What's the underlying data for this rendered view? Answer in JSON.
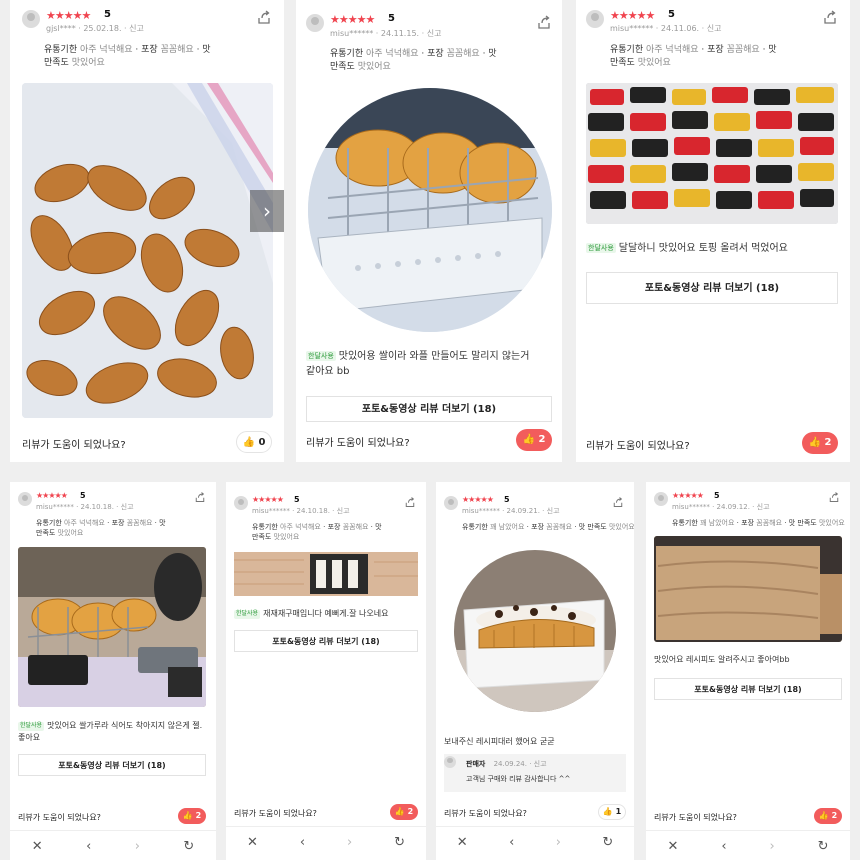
{
  "common": {
    "stars": "★★★★★",
    "score": "5",
    "report": "신고",
    "helpful_q": "리뷰가 도움이 되었나요?",
    "more_btn": "포토&동영상 리뷰 더보기 (18)",
    "badge": "한달사용",
    "share_icon": "share-icon",
    "like_icon": "thumbs-up-icon"
  },
  "colors": {
    "accent": "#f25c5c",
    "star": "#f0444f",
    "badge_green": "#2c9a3a"
  },
  "cards": [
    {
      "user": "gjsl****",
      "date": "25.02.18.",
      "tags_line1": "유통기한",
      "tags_line1_val": "아주 넉넉해요",
      "tags_line2": "포장",
      "tags_line2_val": "꼼꼼해요",
      "tags_line3": "맛",
      "tags_line4": "만족도",
      "tags_line4_val": "맛있어요",
      "votes": "0"
    },
    {
      "user": "misu******",
      "date": "24.11.15.",
      "tags_line1": "유통기한",
      "tags_line1_val": "아주 넉넉해요",
      "tags_line2": "포장",
      "tags_line2_val": "꼼꼼해요",
      "tags_line3": "맛",
      "tags_line4": "만족도",
      "tags_line4_val": "맛있어요",
      "review": "맛있어용 쌀이라 와플 만들어도 말리지 않는거 같아요 bb",
      "votes": "2"
    },
    {
      "user": "misu******",
      "date": "24.11.06.",
      "tags_line1": "유통기한",
      "tags_line1_val": "아주 넉넉해요",
      "tags_line2": "포장",
      "tags_line2_val": "꼼꼼해요",
      "tags_line3": "맛",
      "tags_line4": "만족도",
      "tags_line4_val": "맛있어요",
      "review": "달달하니 맛있어요 토핑 올려서 먹었어요",
      "votes": "2"
    },
    {
      "user": "misu******",
      "date": "24.10.18.",
      "tags_line1": "유통기한",
      "tags_line1_val": "아주 넉넉해요",
      "tags_line2": "포장",
      "tags_line2_val": "꼼꼼해요",
      "tags_line3": "맛",
      "tags_line4": "만족도",
      "tags_line4_val": "맛있어요",
      "review": "맛있어요 쌀가루라 식어도 착아지지 않은게 젤. 좋아요",
      "votes": "2"
    },
    {
      "user": "misu******",
      "date": "24.10.18.",
      "tags_line1": "유통기한",
      "tags_line1_val": "아주 넉넉해요",
      "tags_line2": "포장",
      "tags_line2_val": "꼼꼼해요",
      "tags_line3": "맛",
      "tags_line4": "만족도",
      "tags_line4_val": "맛있어요",
      "review": "재재재구매입니다 예뻐게.잘 나오네요",
      "votes": "2"
    },
    {
      "user": "misu******",
      "date": "24.09.21.",
      "tags_line1": "유통기한",
      "tags_line1_val": "꽤 남았어요",
      "tags_line2": "포장",
      "tags_line2_val": "꼼꼼해요",
      "tags_line3": "맛",
      "tags_line4": "만족도",
      "tags_line4_val": "맛있어요",
      "review": "보내주신 레시피대러 했어요 굳굳",
      "reply_author": "판매자",
      "reply_date": "24.09.24.",
      "reply_text": "고객님 구매와 리뷰 감사합니다 ^^",
      "votes": "1"
    },
    {
      "user": "misu******",
      "date": "24.09.12.",
      "tags_line1": "유통기한",
      "tags_line1_val": "꽤 남았어요",
      "tags_line2": "포장",
      "tags_line2_val": "꼼꼼해요",
      "tags_line3": "맛",
      "tags_line4": "만족도",
      "tags_line4_val": "맛있어요",
      "review": "맛있어요 레시피도 알려주시고 좋아여bb",
      "votes": "2"
    }
  ],
  "navbar": {
    "close": "✕",
    "back": "‹",
    "forward": "›",
    "reload": "↻"
  }
}
